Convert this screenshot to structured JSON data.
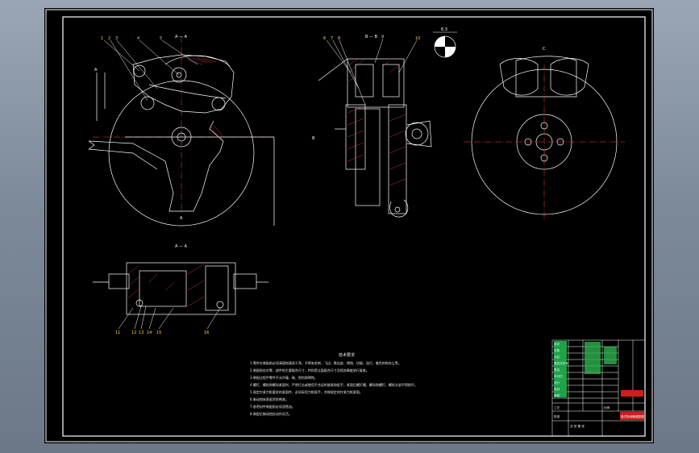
{
  "drawing": {
    "section_labels": {
      "view_a": "A — A",
      "view_b": "B — B",
      "arrow_a_left": "A",
      "arrow_a_bottom": "A",
      "arrow_b": "B",
      "view_c": "C",
      "roughness": "6.3"
    },
    "part_numbers_top_left": [
      "1",
      "2",
      "3",
      "4",
      "5"
    ],
    "part_numbers_top_mid": [
      "6",
      "7",
      "8",
      "9",
      "10"
    ],
    "part_numbers_bottom": [
      "11",
      "12",
      "13",
      "14",
      "15",
      "16"
    ],
    "notes_title": "技术要求",
    "notes": [
      "1.零件在装配前必须清理和清洗干净，不得有毛刺、飞边、氧化皮、锈蚀、切屑、油污、着色剂和灰尘等。",
      "2.装配前应对零、部件的主要配合尺寸，特别是过盈配合尺寸及相关精度进行复查。",
      "3.装配过程中零件不允许磕、碰、划伤和锈蚀。",
      "4.螺钉、螺栓和螺母紧固时，严禁打击或使用不合适的旋具和扳手。紧固后螺钉槽、螺母和螺钉、螺栓头部不得损坏。",
      "5.规定拧紧力矩要求的紧固件，必须采用力矩扳手，并按规定的拧紧力矩紧固。",
      "6.制动钳体表面涂防锈漆。",
      "7.各密封件装配前必须浸透油。",
      "8.装配后制动钳应动作灵活。"
    ]
  },
  "title_block": {
    "drawing_name": "盘式制动器装配图",
    "rows": [
      "标记",
      "处数",
      "分区",
      "更改文件号",
      "签名",
      "年月日",
      "设计",
      "校对",
      "审核",
      "工艺",
      "批准"
    ],
    "scale_label": "比例",
    "sheet_label": "共 张 第 张"
  }
}
